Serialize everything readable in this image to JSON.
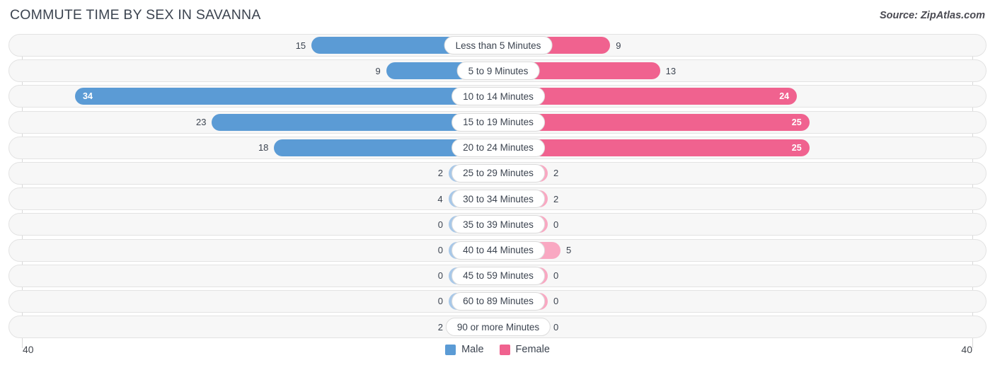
{
  "header": {
    "title": "COMMUTE TIME BY SEX IN SAVANNA",
    "source": "Source: ZipAtlas.com"
  },
  "axis": {
    "left_end": "40",
    "right_end": "40"
  },
  "legend": {
    "items": [
      {
        "label": "Male",
        "color": "#5b9bd5"
      },
      {
        "label": "Female",
        "color": "#f0628f"
      }
    ]
  },
  "colors": {
    "male_strong": "#5b9bd5",
    "male_light": "#a8c8e8",
    "female_strong": "#f0628f",
    "female_light": "#f9a8c2",
    "track": "#f7f7f7",
    "track_border": "#e3e3e3"
  },
  "chart_data": {
    "type": "bar",
    "subtype": "diverging-bidirectional",
    "title": "COMMUTE TIME BY SEX IN SAVANNA",
    "xlabel": "",
    "ylabel": "",
    "xlim": [
      -40,
      40
    ],
    "axis_max": 40,
    "grid": false,
    "legend_position": "bottom-center",
    "categories": [
      "Less than 5 Minutes",
      "5 to 9 Minutes",
      "10 to 14 Minutes",
      "15 to 19 Minutes",
      "20 to 24 Minutes",
      "25 to 29 Minutes",
      "30 to 34 Minutes",
      "35 to 39 Minutes",
      "40 to 44 Minutes",
      "45 to 59 Minutes",
      "60 to 89 Minutes",
      "90 or more Minutes"
    ],
    "series": [
      {
        "name": "Male",
        "color": "#5b9bd5",
        "direction": "left",
        "values": [
          15,
          9,
          34,
          23,
          18,
          2,
          4,
          0,
          0,
          0,
          0,
          2
        ]
      },
      {
        "name": "Female",
        "color": "#f0628f",
        "direction": "right",
        "values": [
          9,
          13,
          24,
          25,
          25,
          2,
          2,
          0,
          5,
          0,
          0,
          0
        ]
      }
    ],
    "rows": [
      {
        "category": "Less than 5 Minutes",
        "male": 15,
        "female": 9,
        "male_label": "15",
        "female_label": "9",
        "male_inside": false,
        "female_inside": false,
        "male_tone": "strong",
        "female_tone": "strong"
      },
      {
        "category": "5 to 9 Minutes",
        "male": 9,
        "female": 13,
        "male_label": "9",
        "female_label": "13",
        "male_inside": false,
        "female_inside": false,
        "male_tone": "strong",
        "female_tone": "strong"
      },
      {
        "category": "10 to 14 Minutes",
        "male": 34,
        "female": 24,
        "male_label": "34",
        "female_label": "24",
        "male_inside": true,
        "female_inside": true,
        "male_tone": "strong",
        "female_tone": "strong"
      },
      {
        "category": "15 to 19 Minutes",
        "male": 23,
        "female": 25,
        "male_label": "23",
        "female_label": "25",
        "male_inside": false,
        "female_inside": true,
        "male_tone": "strong",
        "female_tone": "strong"
      },
      {
        "category": "20 to 24 Minutes",
        "male": 18,
        "female": 25,
        "male_label": "18",
        "female_label": "25",
        "male_inside": false,
        "female_inside": true,
        "male_tone": "strong",
        "female_tone": "strong"
      },
      {
        "category": "25 to 29 Minutes",
        "male": 2,
        "female": 2,
        "male_label": "2",
        "female_label": "2",
        "male_inside": false,
        "female_inside": false,
        "male_tone": "light",
        "female_tone": "light"
      },
      {
        "category": "30 to 34 Minutes",
        "male": 4,
        "female": 2,
        "male_label": "4",
        "female_label": "2",
        "male_inside": false,
        "female_inside": false,
        "male_tone": "light",
        "female_tone": "light"
      },
      {
        "category": "35 to 39 Minutes",
        "male": 0,
        "female": 0,
        "male_label": "0",
        "female_label": "0",
        "male_inside": false,
        "female_inside": false,
        "male_tone": "light",
        "female_tone": "light"
      },
      {
        "category": "40 to 44 Minutes",
        "male": 0,
        "female": 5,
        "male_label": "0",
        "female_label": "5",
        "male_inside": false,
        "female_inside": false,
        "male_tone": "light",
        "female_tone": "light"
      },
      {
        "category": "45 to 59 Minutes",
        "male": 0,
        "female": 0,
        "male_label": "0",
        "female_label": "0",
        "male_inside": false,
        "female_inside": false,
        "male_tone": "light",
        "female_tone": "light"
      },
      {
        "category": "60 to 89 Minutes",
        "male": 0,
        "female": 0,
        "male_label": "0",
        "female_label": "0",
        "male_inside": false,
        "female_inside": false,
        "male_tone": "light",
        "female_tone": "light"
      },
      {
        "category": "90 or more Minutes",
        "male": 2,
        "female": 0,
        "male_label": "2",
        "female_label": "0",
        "male_inside": false,
        "female_inside": false,
        "male_tone": "light",
        "female_tone": "light"
      }
    ]
  }
}
